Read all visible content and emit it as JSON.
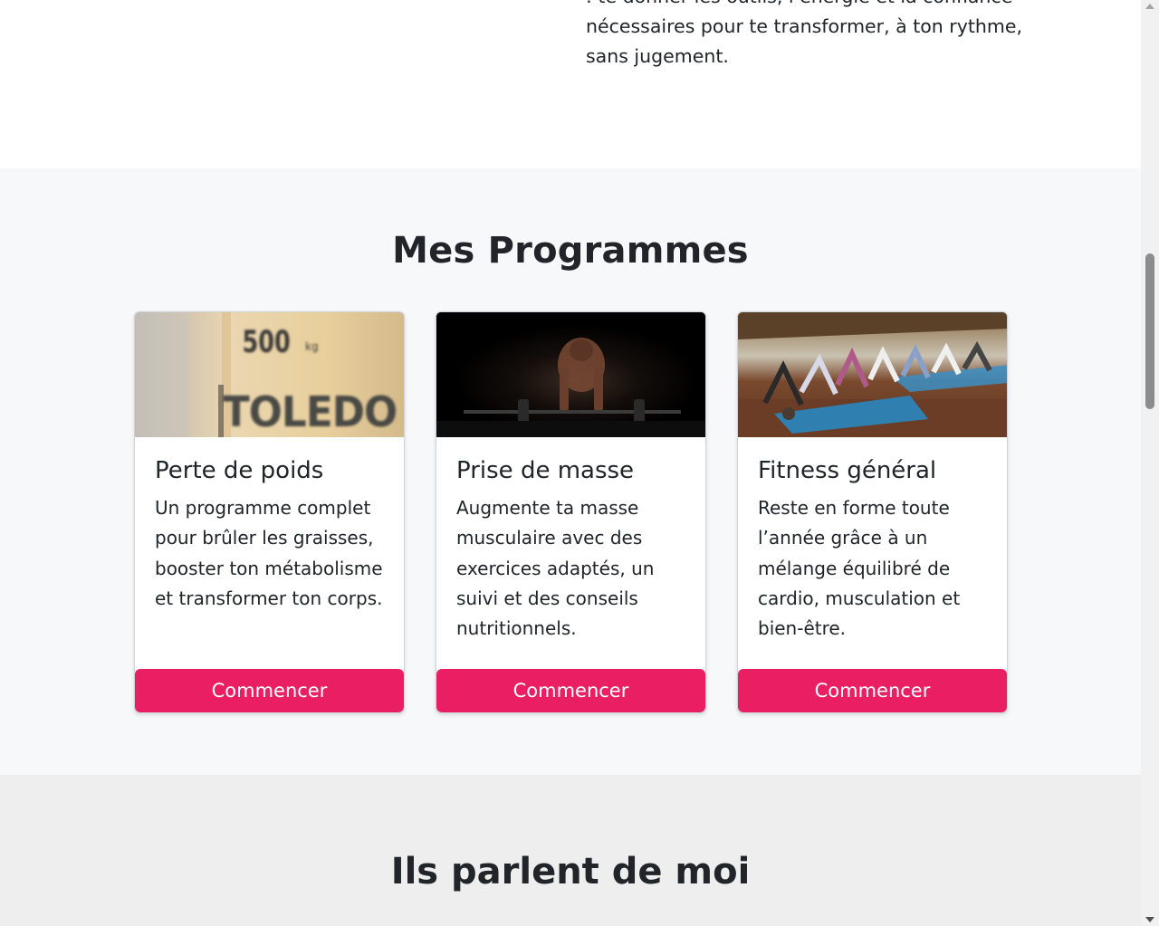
{
  "about": {
    "text": ": te donner les outils, l’énergie et la confiance nécessaires pour te transformer, à ton rythme, sans jugement."
  },
  "programs": {
    "heading": "Mes Programmes",
    "cards": [
      {
        "image": "toledo-scale-500kg-photo",
        "image_text": "TOLEDO",
        "image_sub": "500kg",
        "title": "Perte de poids",
        "description": "Un programme complet pour brûler les graisses, booster ton métabolisme et transformer ton corps.",
        "button": "Commencer"
      },
      {
        "image": "deadlift-athlete-dark-photo",
        "title": "Prise de masse",
        "description": "Augmente ta masse musculaire avec des exercices adaptés, un suivi et des conseils nutritionnels.",
        "button": "Commencer"
      },
      {
        "image": "group-yoga-class-photo",
        "title": "Fitness général",
        "description": "Reste en forme toute l’année grâce à un mélange équilibré de cardio, musculation et bien-être.",
        "button": "Commencer"
      }
    ]
  },
  "testimonials": {
    "heading": "Ils parlent de moi"
  },
  "colors": {
    "accent": "#e91e63",
    "programs_bg": "#f7f8fa",
    "testimonials_bg": "#eeeeee",
    "text": "#212529"
  }
}
